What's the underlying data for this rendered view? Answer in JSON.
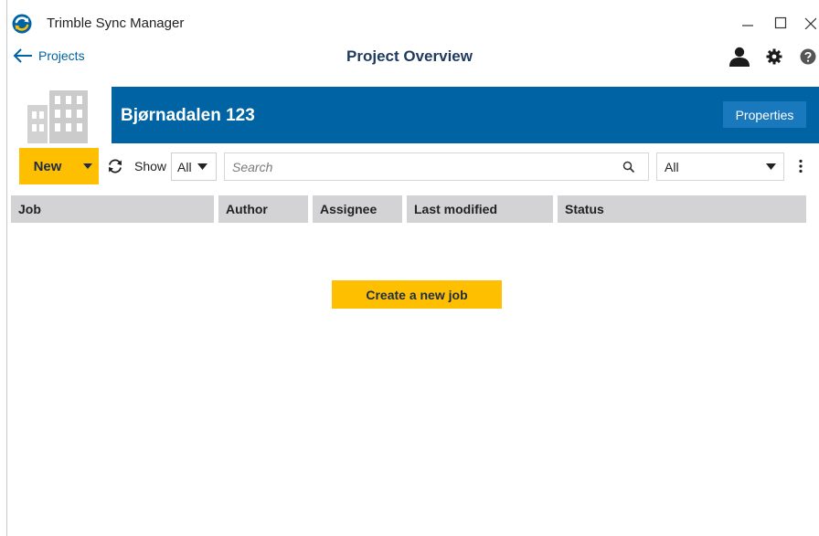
{
  "app": {
    "title": "Trimble Sync Manager"
  },
  "nav": {
    "back_label": "Projects",
    "page_title": "Project Overview"
  },
  "project": {
    "name": "Bjørnadalen 123",
    "properties_label": "Properties"
  },
  "toolbar": {
    "new_label": "New",
    "show_label": "Show",
    "show_value": "All",
    "search_placeholder": "Search",
    "filter_value": "All"
  },
  "table": {
    "columns": [
      "Job",
      "Author",
      "Assignee",
      "Last modified",
      "Status"
    ]
  },
  "empty_state": {
    "create_label": "Create a new job"
  },
  "colors": {
    "accent_yellow": "#fdbf00",
    "brand_blue": "#0063a3",
    "header_gray": "#d3d3d5"
  },
  "icons": [
    "app-logo-icon",
    "minimize-icon",
    "maximize-icon",
    "close-icon",
    "arrow-left-icon",
    "user-icon",
    "gear-icon",
    "help-icon",
    "building-icon",
    "caret-down-icon",
    "refresh-icon",
    "search-icon",
    "kebab-menu-icon"
  ]
}
